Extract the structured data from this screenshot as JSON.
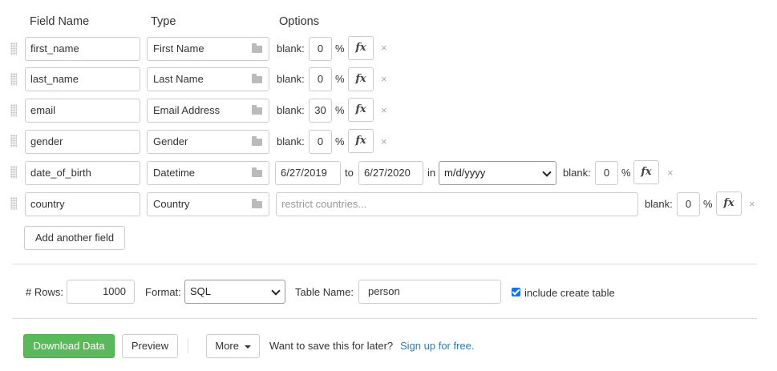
{
  "headers": {
    "field_name": "Field Name",
    "type": "Type",
    "options": "Options"
  },
  "fields": [
    {
      "name": "first_name",
      "type": "First Name",
      "blank_label": "blank:",
      "blank_value": "0",
      "pct": "%",
      "fx": "fx",
      "remove": "×"
    },
    {
      "name": "last_name",
      "type": "Last Name",
      "blank_label": "blank:",
      "blank_value": "0",
      "pct": "%",
      "fx": "fx",
      "remove": "×"
    },
    {
      "name": "email",
      "type": "Email Address",
      "blank_label": "blank:",
      "blank_value": "30",
      "pct": "%",
      "fx": "fx",
      "remove": "×"
    },
    {
      "name": "gender",
      "type": "Gender",
      "blank_label": "blank:",
      "blank_value": "0",
      "pct": "%",
      "fx": "fx",
      "remove": "×"
    },
    {
      "name": "date_of_birth",
      "type": "Datetime",
      "from": "6/27/2019",
      "to_label": "to",
      "to": "6/27/2020",
      "in_label": "in",
      "format": "m/d/yyyy",
      "blank_label": "blank:",
      "blank_value": "0",
      "pct": "%",
      "fx": "fx",
      "remove": "×"
    },
    {
      "name": "country",
      "type": "Country",
      "placeholder": "restrict countries...",
      "blank_label": "blank:",
      "blank_value": "0",
      "pct": "%",
      "fx": "fx",
      "remove": "×"
    }
  ],
  "add_field": "Add another field",
  "settings": {
    "rows_label": "# Rows:",
    "rows_value": "1000",
    "format_label": "Format:",
    "format_value": "SQL",
    "table_label": "Table Name:",
    "table_value": "person",
    "create_table_label": "include create table",
    "create_table_checked": true
  },
  "actions": {
    "download": "Download Data",
    "preview": "Preview",
    "more": "More",
    "save_prompt": "Want to save this for later?",
    "signup": "Sign up for free."
  },
  "colors": {
    "primary_green": "#5cb85c",
    "link_blue": "#337ab7",
    "checkbox_blue": "#1a73e8"
  }
}
